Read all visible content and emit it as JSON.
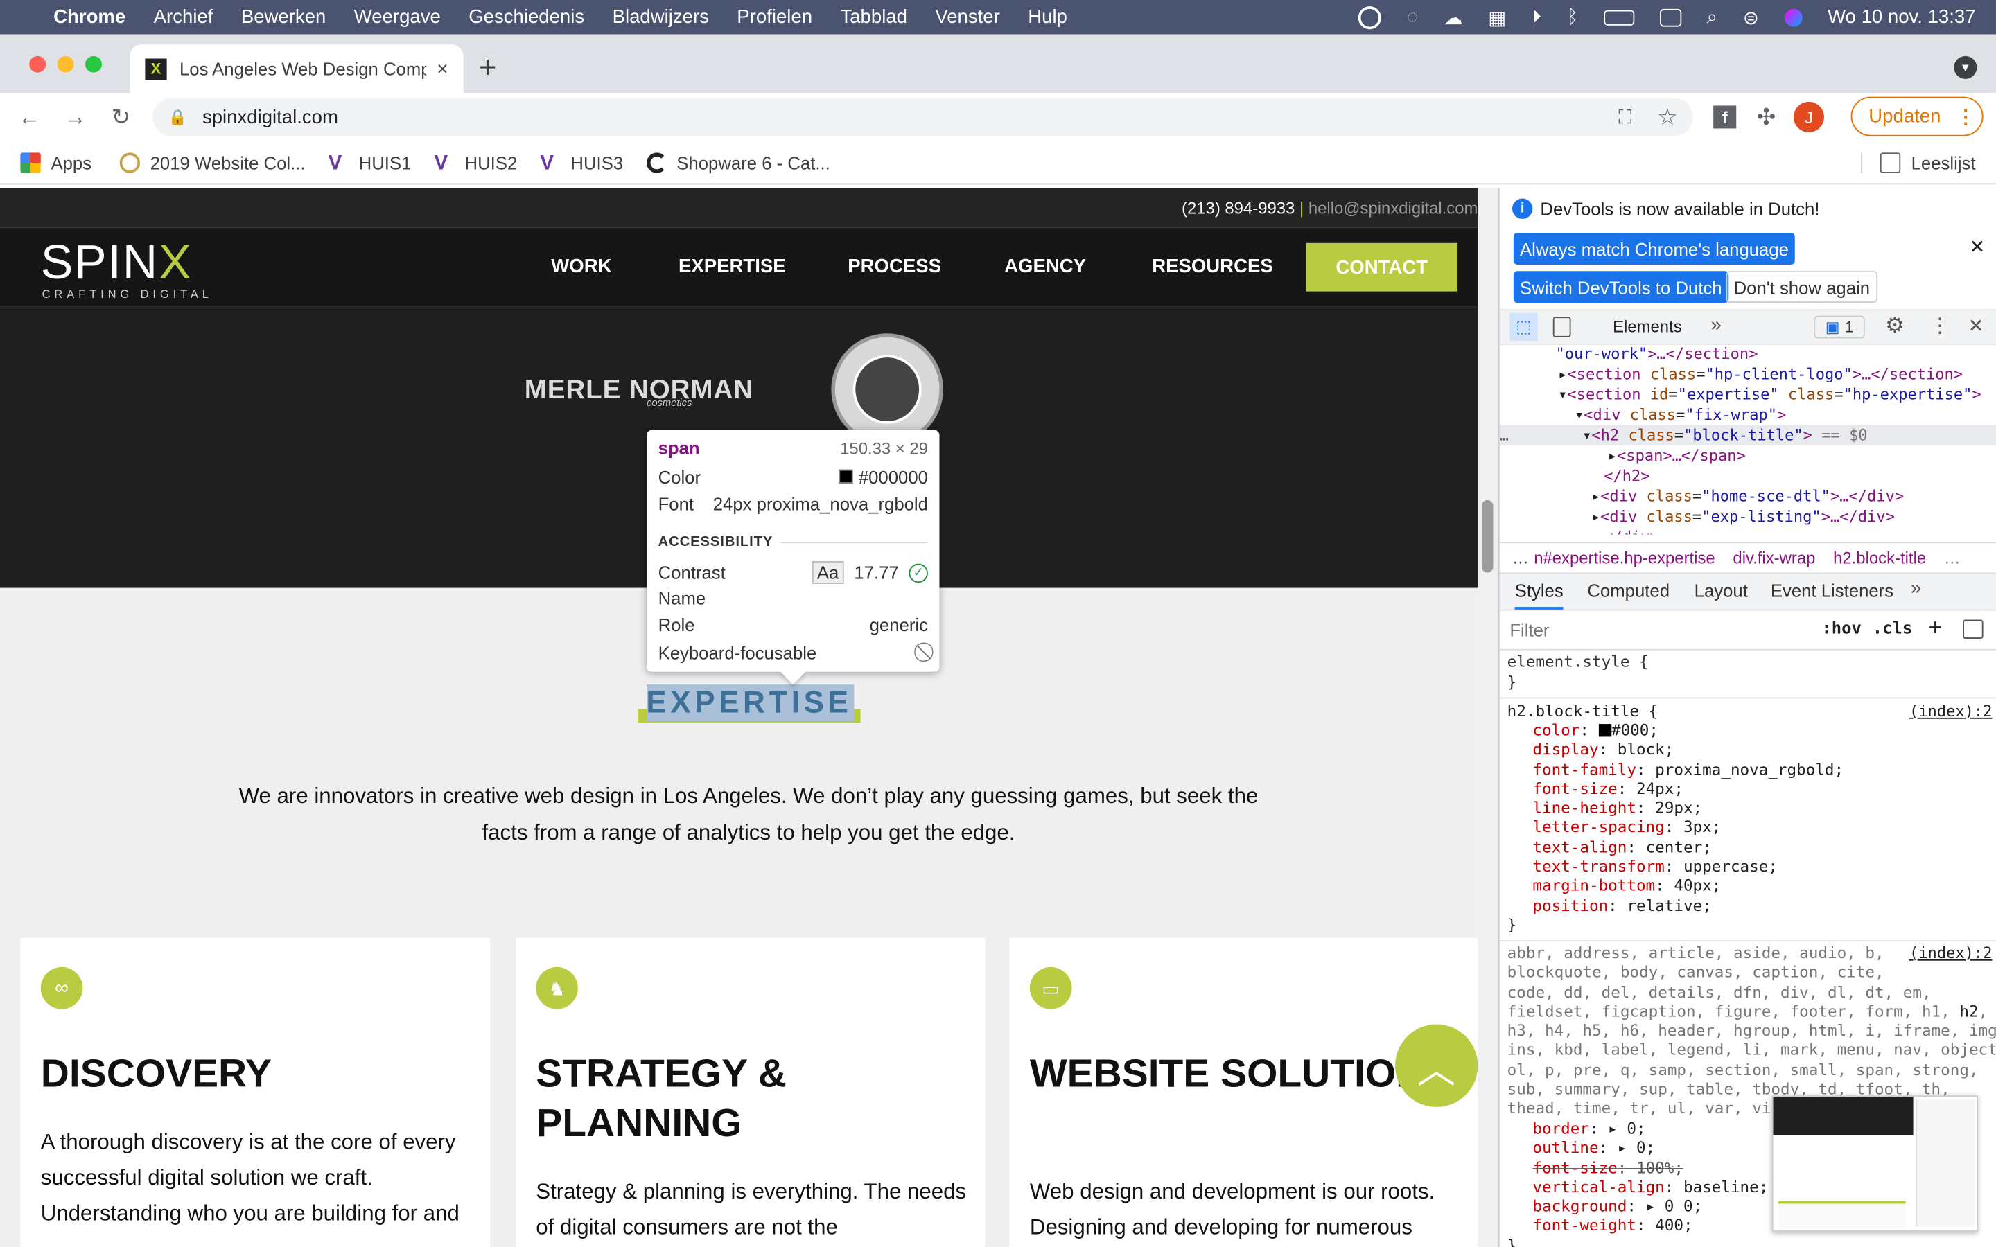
{
  "menubar": {
    "app": "Chrome",
    "items": [
      "Archief",
      "Bewerken",
      "Weergave",
      "Geschiedenis",
      "Bladwijzers",
      "Profielen",
      "Tabblad",
      "Venster",
      "Hulp"
    ],
    "clock": "Wo 10 nov.  13:37"
  },
  "tab": {
    "title": "Los Angeles Web Design Comp",
    "close": "×",
    "new": "+"
  },
  "toolbar": {
    "url": "spinxdigital.com",
    "update_label": "Updaten",
    "profile_initial": "J"
  },
  "bookmarks": {
    "items": [
      "Apps",
      "2019 Website Col...",
      "HUIS1",
      "HUIS2",
      "HUIS3",
      "Shopware 6 - Cat..."
    ],
    "reading_list": "Leeslijst"
  },
  "site": {
    "phone": "(213) 894-9933",
    "email": "hello@spinxdigital.com",
    "logo_main": "SPIN",
    "logo_x": "X",
    "logo_sub": "CRAFTING DIGITAL",
    "nav": [
      "WORK",
      "EXPERTISE",
      "PROCESS",
      "AGENCY",
      "RESOURCES"
    ],
    "contact": "CONTACT",
    "client_logo": "MERLE NORMAN",
    "client_logo_sub": "cosmetics",
    "section_title": "EXPERTISE",
    "intro": "We are innovators in creative web design in Los Angeles. We don’t play any guessing games, but seek the facts from a range of analytics to help you get the edge.",
    "cards": [
      {
        "title": "DISCOVERY",
        "text": "A thorough discovery is at the core of every successful digital solution we craft. Understanding who you are building for and"
      },
      {
        "title": "STRATEGY & PLANNING",
        "text": "Strategy & planning is everything. The needs of digital consumers are not the"
      },
      {
        "title": "WEBSITE SOLUTIONS",
        "text": "Web design and development is our roots. Designing and developing for numerous"
      }
    ]
  },
  "tooltip": {
    "tag": "span",
    "size": "150.33 × 29",
    "color_label": "Color",
    "color_value": "#000000",
    "font_label": "Font",
    "font_value": "24px proxima_nova_rgbold",
    "section": "ACCESSIBILITY",
    "contrast_label": "Contrast",
    "contrast_aa": "Aa",
    "contrast_value": "17.77",
    "name_label": "Name",
    "role_label": "Role",
    "role_value": "generic",
    "focus_label": "Keyboard-focusable"
  },
  "devtools": {
    "notice": "DevTools is now available in Dutch!",
    "btn_match": "Always match Chrome's language",
    "btn_switch": "Switch DevTools to Dutch",
    "btn_dont": "Don't show again",
    "panel_tab": "Elements",
    "issues_count": "1",
    "breadcrumbs": [
      "…",
      "n#expertise.hp-expertise",
      "div.fix-wrap",
      "h2.block-title",
      "…"
    ],
    "subtabs": [
      "Styles",
      "Computed",
      "Layout",
      "Event Listeners"
    ],
    "filter_placeholder": "Filter",
    "hov": ":hov",
    "cls": ".cls",
    "plus": "+",
    "rule_source": "(index):2",
    "element_style": "element.style {",
    "rule_selector": "h2.block-title {",
    "close_brace": "}"
  }
}
